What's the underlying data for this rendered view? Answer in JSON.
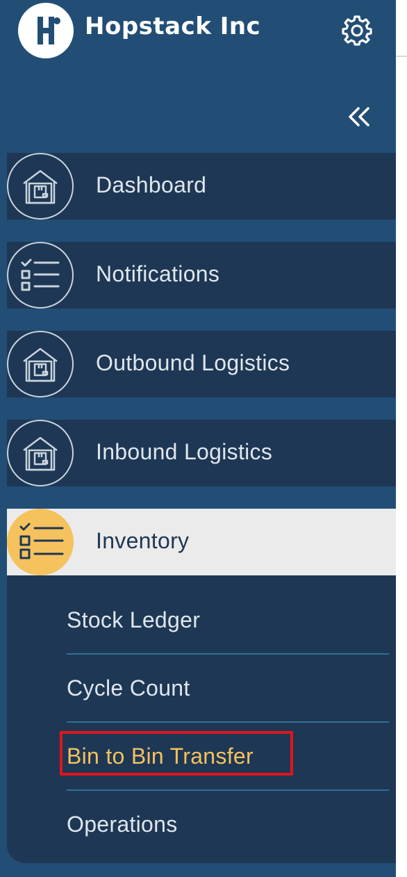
{
  "brand": {
    "name": "Hopstack Inc",
    "logo_letter": "H"
  },
  "header": {
    "settings_icon": "gear-icon",
    "collapse_icon": "double-chevron-left-icon"
  },
  "nav": {
    "items": [
      {
        "label": "Dashboard",
        "icon": "warehouse-icon"
      },
      {
        "label": "Notifications",
        "icon": "checklist-icon"
      },
      {
        "label": "Outbound Logistics",
        "icon": "warehouse-icon"
      },
      {
        "label": "Inbound Logistics",
        "icon": "warehouse-icon"
      },
      {
        "label": "Inventory",
        "icon": "checklist-icon",
        "active": true
      }
    ]
  },
  "submenu": {
    "items": [
      {
        "label": "Stock Ledger"
      },
      {
        "label": "Cycle Count"
      },
      {
        "label": "Bin to Bin Transfer",
        "highlighted": true
      },
      {
        "label": "Operations"
      }
    ]
  },
  "colors": {
    "sidebar_bg": "#224e75",
    "item_bg": "#1e3754",
    "active_bg": "#ebebeb",
    "accent": "#f5c25e",
    "highlight_border": "#e0151b"
  }
}
